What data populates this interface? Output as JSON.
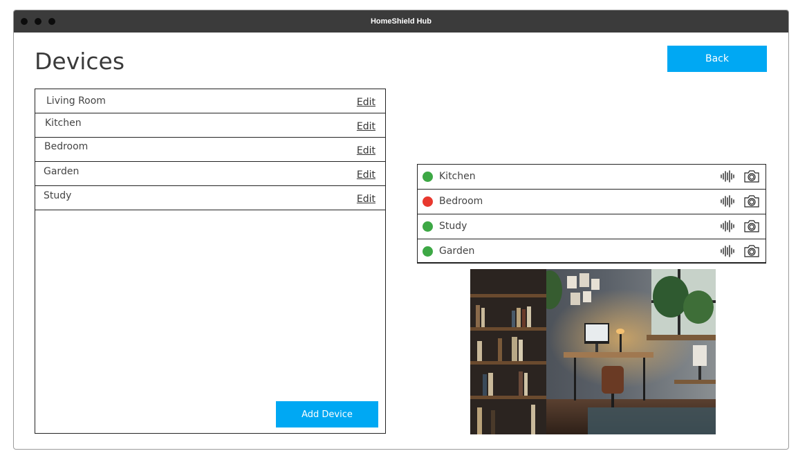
{
  "window": {
    "title": "HomeShield Hub"
  },
  "page": {
    "title": "Devices"
  },
  "header": {
    "back_label": "Back"
  },
  "rooms": {
    "items": [
      {
        "name": "Living Room",
        "edit_label": "Edit"
      },
      {
        "name": "Kitchen",
        "edit_label": "Edit"
      },
      {
        "name": "Bedroom",
        "edit_label": "Edit"
      },
      {
        "name": "Garden",
        "edit_label": "Edit"
      },
      {
        "name": "Study",
        "edit_label": "Edit"
      }
    ],
    "add_label": "Add Device"
  },
  "status": {
    "items": [
      {
        "name": "Kitchen",
        "state": "online",
        "color": "#3da845",
        "icons": [
          "audio-icon",
          "camera-icon"
        ]
      },
      {
        "name": "Bedroom",
        "state": "alert",
        "color": "#e8382e",
        "icons": [
          "audio-icon",
          "camera-icon"
        ]
      },
      {
        "name": "Study",
        "state": "online",
        "color": "#3da845",
        "icons": [
          "audio-icon",
          "camera-icon"
        ]
      },
      {
        "name": "Garden",
        "state": "online",
        "color": "#3da845",
        "icons": [
          "audio-icon",
          "camera-icon"
        ]
      }
    ]
  },
  "colors": {
    "accent": "#00a8f3",
    "titlebar": "#3b3b3b",
    "online": "#3da845",
    "alert": "#e8382e"
  }
}
